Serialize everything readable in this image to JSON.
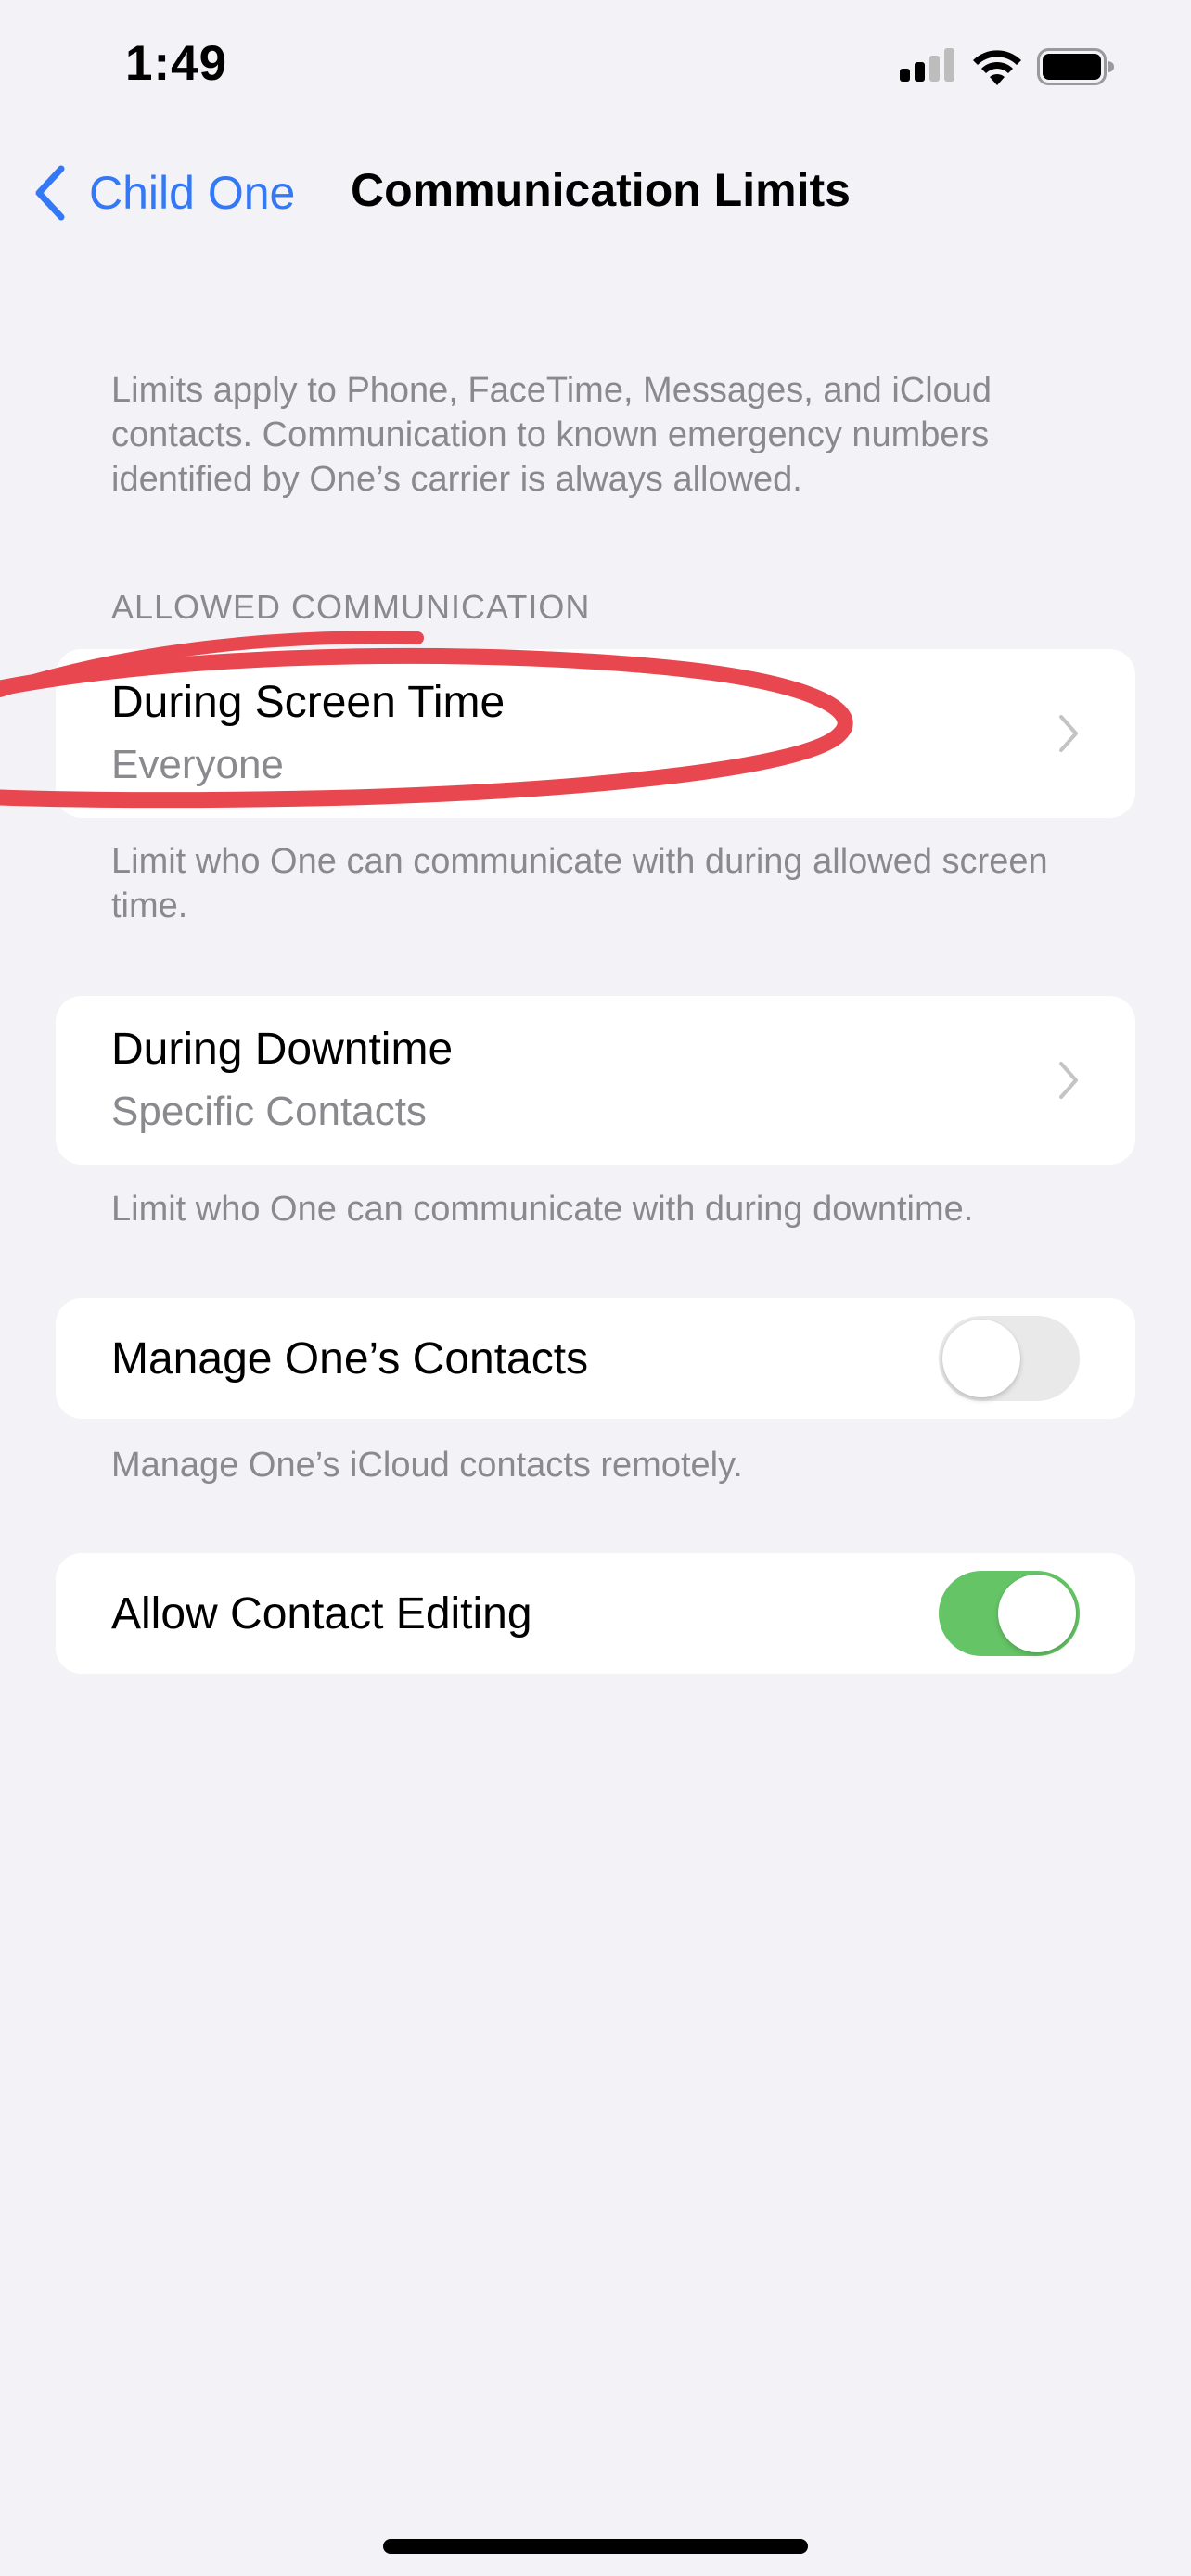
{
  "status_bar": {
    "time": "1:49",
    "icons": [
      "cellular-signal-icon",
      "wifi-icon",
      "battery-icon"
    ]
  },
  "nav": {
    "back_label": "Child One",
    "title": "Communication Limits",
    "back_icon": "chevron-left-icon"
  },
  "intro_text": "Limits apply to Phone, FaceTime, Messages, and iCloud contacts. Communication to known emergency numbers identified by One’s carrier is always allowed.",
  "allowed_communication": {
    "header": "ALLOWED COMMUNICATION",
    "during_screen_time": {
      "title": "During Screen Time",
      "value": "Everyone",
      "footer": "Limit who One can communicate with during allowed screen time."
    },
    "during_downtime": {
      "title": "During Downtime",
      "value": "Specific Contacts",
      "footer": "Limit who One can communicate with during downtime."
    }
  },
  "manage_contacts": {
    "title": "Manage One’s Contacts",
    "enabled": false,
    "footer": "Manage One’s iCloud contacts remotely."
  },
  "allow_contact_editing": {
    "title": "Allow Contact Editing",
    "enabled": true
  },
  "colors": {
    "background": "#F2F2F7",
    "accent": "#3478F6",
    "toggle_on": "#65C466",
    "toggle_off": "#E9E9EA",
    "secondary_text": "#8A8A8E",
    "annotation": "#E8474F"
  }
}
